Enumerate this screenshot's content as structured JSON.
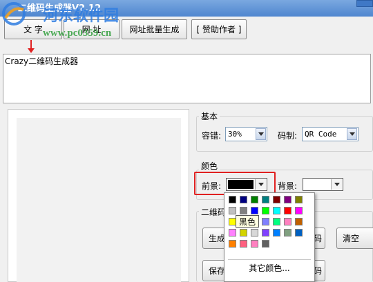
{
  "window": {
    "title": "二维码生成器V2.12",
    "accent": "#4f86cf"
  },
  "watermark": {
    "brand": "河东软件园",
    "url": "www.pc0359.cn"
  },
  "toolbar": {
    "text_label": "文 字",
    "url_label": "网 址",
    "batch_label": "网址批量生成",
    "sponsor_label": "[ 赞助作者 ]"
  },
  "input": {
    "value": "Crazy二维码生成器"
  },
  "basic": {
    "group_title": "基本",
    "tolerance_label": "容错:",
    "tolerance_value": "30%",
    "code_label": "码制:",
    "code_value": "QR Code"
  },
  "color": {
    "group_title": "颜色",
    "fg_label": "前景:",
    "fg_color": "#000000",
    "bg_label": "背景:",
    "bg_color": "#ffffff"
  },
  "qr_group": {
    "title": "二维码"
  },
  "buttons": {
    "generate": "生成",
    "clear": "清空",
    "save": "保存",
    "right_partial": "码"
  },
  "palette": {
    "colors": [
      [
        "#000000",
        "#000080",
        "#008000",
        "#008080",
        "#800000",
        "#800080",
        "#808000"
      ],
      [
        "#c0c0c0",
        "#808080",
        "#0000ff",
        "#00ff00",
        "#00ffff",
        "#ff0000",
        "#ff00ff"
      ],
      [
        "#ffff00",
        "#ff8040",
        "#804000",
        "#8080ff",
        "#00ff80",
        "#ff80c0",
        "#c06000"
      ],
      [
        "#ff80ff",
        "#d4d400",
        "#d8d8d8",
        "#8040ff",
        "#0080ff",
        "#80a080",
        "#0060c0"
      ],
      [
        "#ff8000",
        "#ff6080",
        "#ff80c0",
        "#606060"
      ]
    ],
    "tooltip": "黑色",
    "more_label": "其它颜色..."
  }
}
